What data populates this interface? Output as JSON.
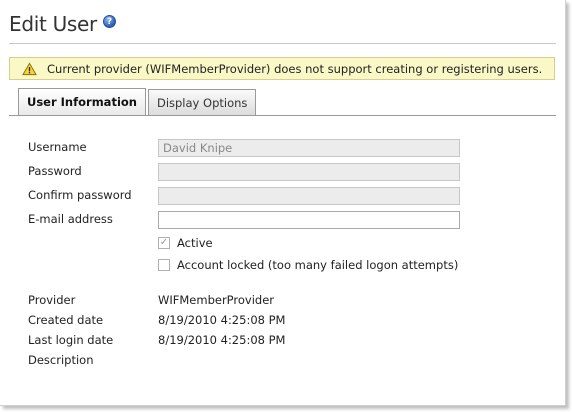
{
  "header": {
    "title": "Edit User",
    "help_icon": "help-icon"
  },
  "warning": {
    "icon": "warning-icon",
    "text": "Current provider (WIFMemberProvider) does not support creating or registering users."
  },
  "tabs": [
    {
      "label": "User Information",
      "active": true
    },
    {
      "label": "Display Options",
      "active": false
    }
  ],
  "form": {
    "username_label": "Username",
    "username_value": "David Knipe",
    "password_label": "Password",
    "password_value": "",
    "confirm_password_label": "Confirm password",
    "confirm_password_value": "",
    "email_label": "E-mail address",
    "email_value": "",
    "active_label": "Active",
    "active_checked": true,
    "locked_label": "Account locked (too many failed logon attempts)",
    "locked_checked": false
  },
  "info": {
    "provider_label": "Provider",
    "provider_value": "WIFMemberProvider",
    "created_label": "Created date",
    "created_value": "8/19/2010 4:25:08 PM",
    "last_login_label": "Last login date",
    "last_login_value": "8/19/2010 4:25:08 PM",
    "description_label": "Description",
    "description_value": ""
  },
  "colors": {
    "warning_bg": "#fbf8c8",
    "disabled_field": "#ececec"
  }
}
